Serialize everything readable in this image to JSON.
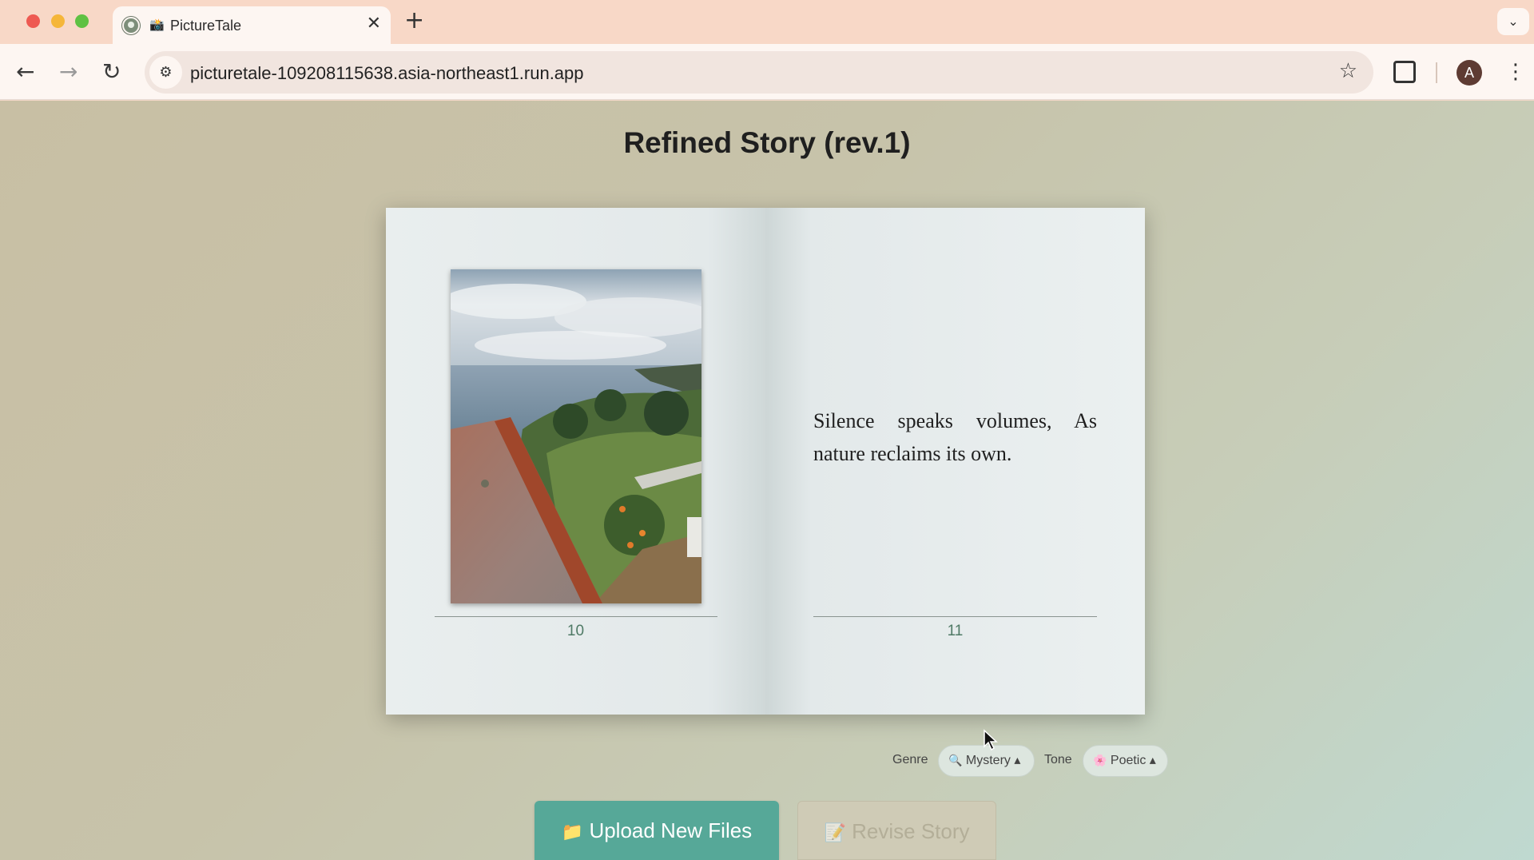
{
  "browser": {
    "tab_title": "PictureTale",
    "tab_emoji": "📸",
    "tab_close": "✕",
    "new_tab": "+",
    "tab_search": "⌄",
    "url": "picturetale-109208115638.asia-northeast1.run.app",
    "nav": {
      "back": "←",
      "forward": "→",
      "reload": "↻"
    },
    "site_info_icon": "⚙",
    "bookmark_icon": "☆",
    "profile_initial": "A",
    "menu_icon": "⋮"
  },
  "page": {
    "title": "Refined Story (rev.1)"
  },
  "book": {
    "left_page": {
      "page_number": "10",
      "image": "coastal-landscape-photo"
    },
    "right_page": {
      "page_number": "11",
      "text": "Silence speaks volumes, As nature reclaims its own."
    }
  },
  "options": {
    "genre_label": "Genre",
    "genre_emoji": "🔍",
    "genre_value": "Mystery ▴",
    "tone_label": "Tone",
    "tone_emoji": "🌸",
    "tone_value": "Poetic ▴"
  },
  "actions": {
    "upload_emoji": "📁",
    "upload_label": "Upload New Files",
    "revise_emoji": "📝",
    "revise_label": "Revise Story",
    "revise_disabled": true
  },
  "colors": {
    "accent": "#56a898",
    "page_number": "#4f7a66",
    "tab_strip": "#f8d8c7"
  }
}
